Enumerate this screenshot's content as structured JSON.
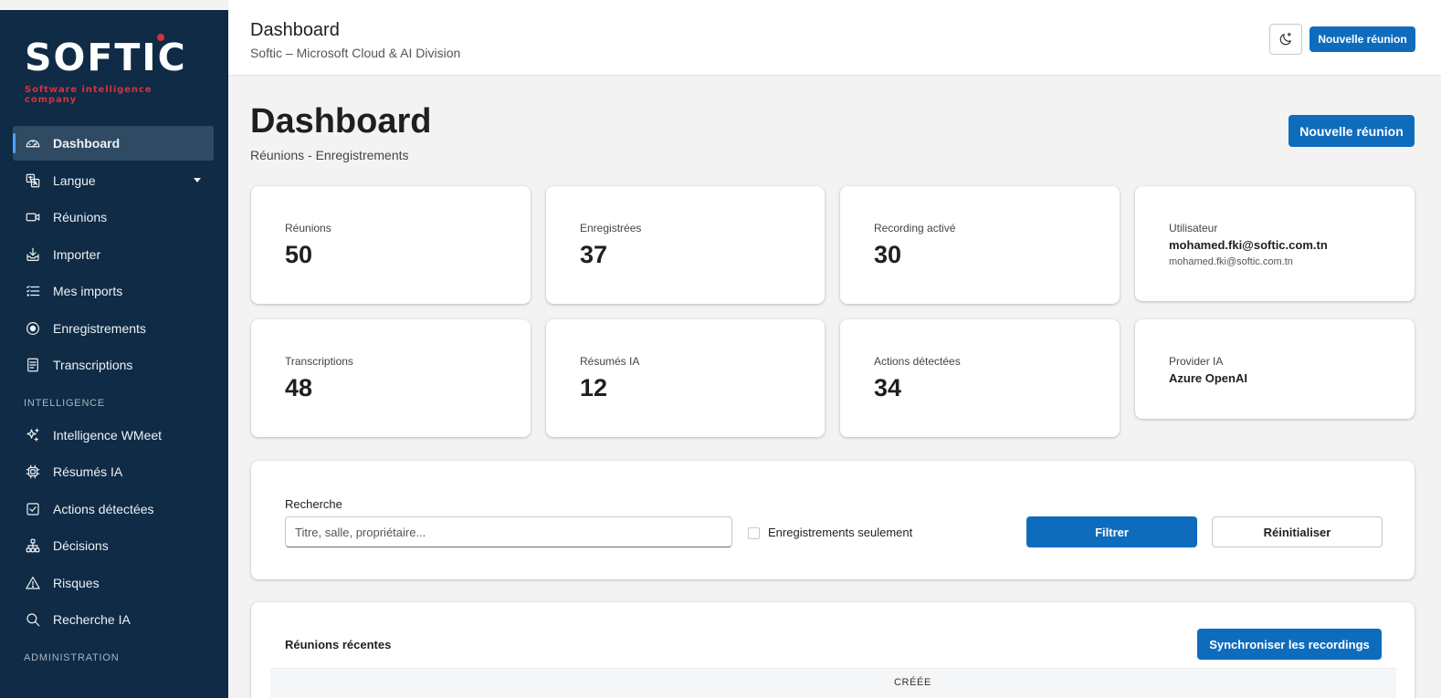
{
  "sidebar": {
    "logo": {
      "brand": "SOFTIC",
      "tagline": "Software intelligence company"
    },
    "items": [
      {
        "label": "Dashboard",
        "icon": "dashboard-icon",
        "active": true
      },
      {
        "label": "Langue",
        "icon": "translate-icon",
        "has_dropdown": true
      },
      {
        "label": "Réunions",
        "icon": "video-icon"
      },
      {
        "label": "Importer",
        "icon": "import-icon"
      },
      {
        "label": "Mes imports",
        "icon": "list-icon"
      },
      {
        "label": "Enregistrements",
        "icon": "record-icon"
      },
      {
        "label": "Transcriptions",
        "icon": "document-icon"
      }
    ],
    "section_intelligence": "INTELLIGENCE",
    "intelligence_items": [
      {
        "label": "Intelligence WMeet",
        "icon": "sparkle-icon"
      },
      {
        "label": "Résumés IA",
        "icon": "chip-icon"
      },
      {
        "label": "Actions détectées",
        "icon": "checkbox-icon"
      },
      {
        "label": "Décisions",
        "icon": "org-chart-icon"
      },
      {
        "label": "Risques",
        "icon": "warning-icon"
      },
      {
        "label": "Recherche IA",
        "icon": "search-icon"
      }
    ],
    "section_admin": "ADMINISTRATION"
  },
  "header": {
    "title": "Dashboard",
    "subtitle": "Softic – Microsoft Cloud & AI Division",
    "theme_icon": "moon-sparkle-icon",
    "new_meeting_label": "Nouvelle réunion"
  },
  "page": {
    "title": "Dashboard",
    "subtitle": "Réunions - Enregistrements",
    "new_meeting_label": "Nouvelle réunion"
  },
  "stats": [
    {
      "label": "Réunions",
      "value": "50"
    },
    {
      "label": "Enregistrées",
      "value": "37"
    },
    {
      "label": "Recording activé",
      "value": "30"
    },
    {
      "label": "Transcriptions",
      "value": "48"
    },
    {
      "label": "Résumés IA",
      "value": "12"
    },
    {
      "label": "Actions détectées",
      "value": "34"
    }
  ],
  "user_card": {
    "label": "Utilisateur",
    "value": "mohamed.fki@softic.com.tn",
    "sub": "mohamed.fki@softic.com.tn"
  },
  "provider_card": {
    "label": "Provider IA",
    "value": "Azure OpenAI"
  },
  "filter": {
    "label": "Recherche",
    "placeholder": "Titre, salle, propriétaire...",
    "checkbox_label": "Enregistrements seulement",
    "filter_button": "Filtrer",
    "reset_button": "Réinitialiser"
  },
  "recent": {
    "title": "Réunions récentes",
    "sync_button": "Synchroniser les recordings",
    "columns": [
      "CRÉÉE"
    ]
  },
  "colors": {
    "sidebar_bg": "#0f2b45",
    "primary": "#0f6cbd",
    "brand_red": "#d6323c"
  }
}
